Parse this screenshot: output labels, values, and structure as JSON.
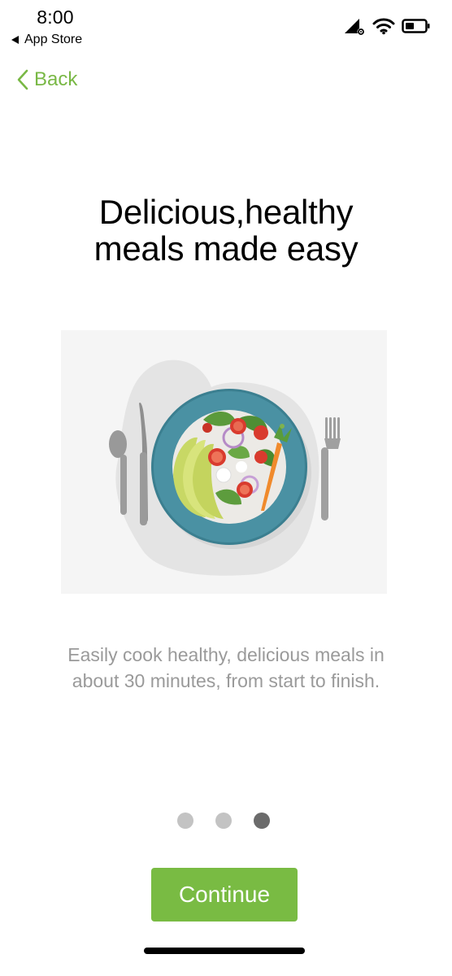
{
  "status_bar": {
    "time": "8:00",
    "back_app": "App Store",
    "icons": [
      "signal-icon",
      "wifi-icon",
      "battery-icon"
    ]
  },
  "nav": {
    "back_label": "Back"
  },
  "onboarding": {
    "title_line1": "Delicious,healthy",
    "title_line2": "meals made easy",
    "illustration": "salad-plate-illustration",
    "description_line1": "Easily cook healthy, delicious meals in",
    "description_line2": "about 30 minutes, from start to finish.",
    "page_count": 3,
    "active_page": 3,
    "continue_label": "Continue"
  },
  "colors": {
    "accent": "#79bb43",
    "back_text": "#79b845",
    "description_text": "#9a9a9a",
    "dot_inactive": "#c3c3c3",
    "dot_active": "#6b6b6b"
  }
}
